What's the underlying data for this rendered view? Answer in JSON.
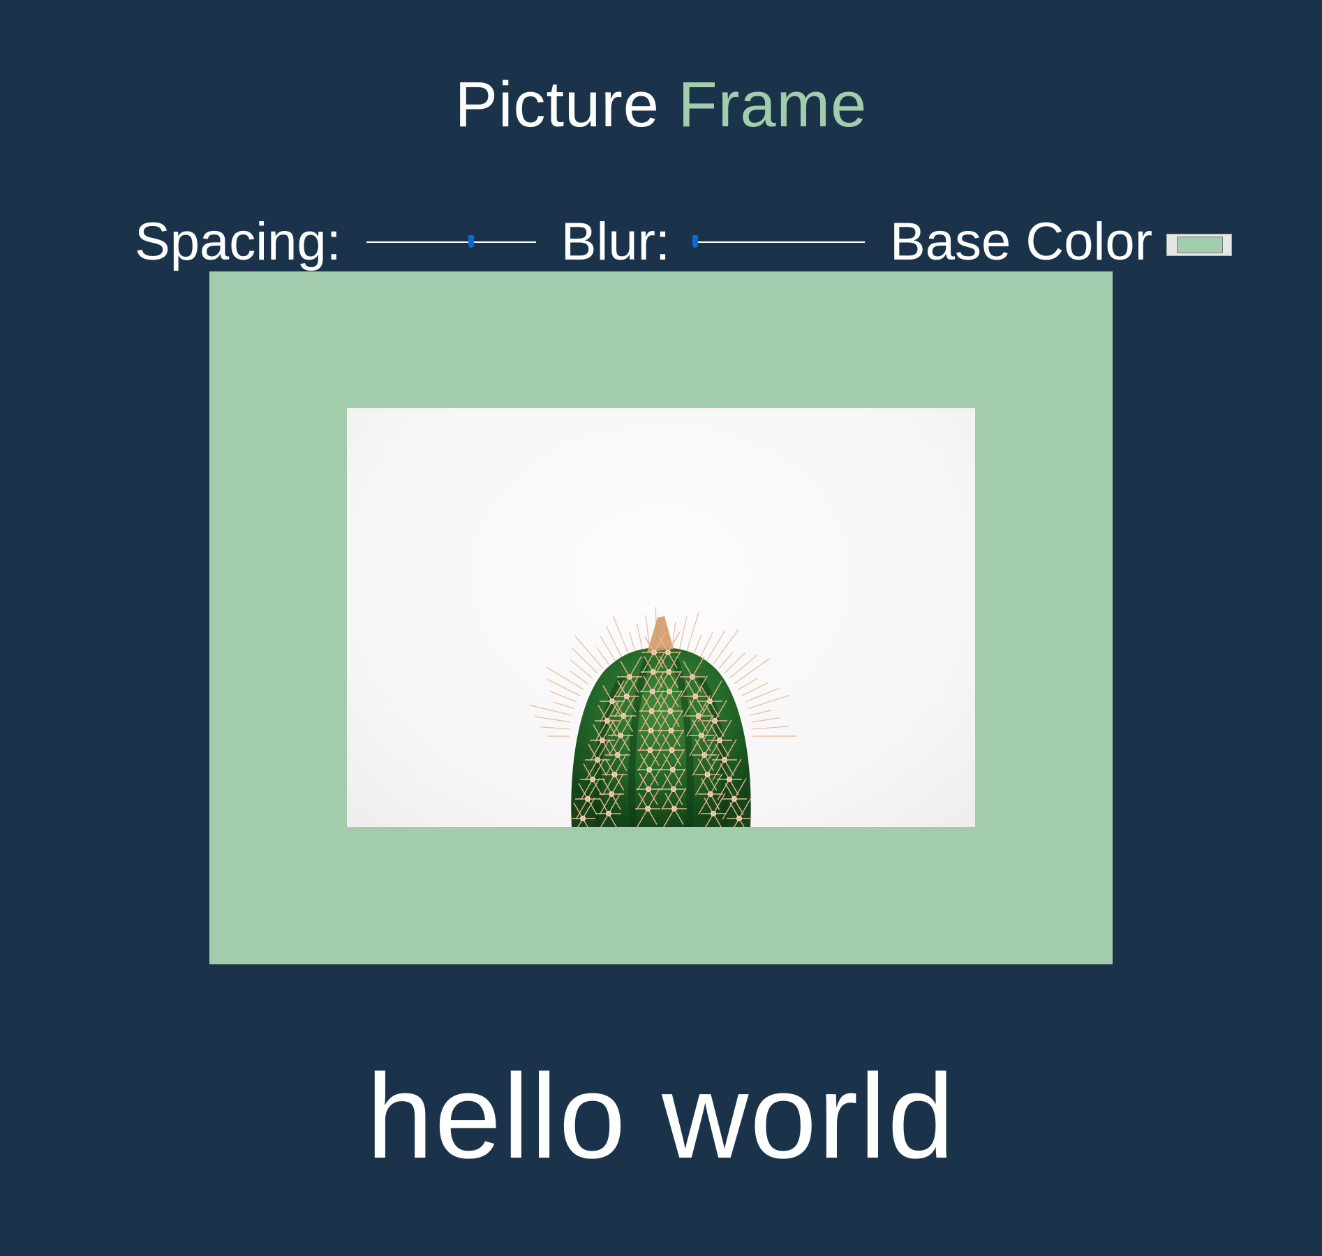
{
  "header": {
    "title_part1": "Picture",
    "title_part2": "Frame"
  },
  "controls": {
    "spacing_label": "Spacing:",
    "spacing_value": 0.62,
    "blur_label": "Blur:",
    "blur_value": 0.0,
    "base_color_label": "Base Color",
    "base_color_value": "#a3ccad"
  },
  "picture": {
    "subject_icon": "cactus-photo"
  },
  "footer": {
    "message": "hello world"
  },
  "colors": {
    "background": "#1a334a",
    "accent": "#a3ccad",
    "slider_thumb": "#0a6ad8"
  }
}
